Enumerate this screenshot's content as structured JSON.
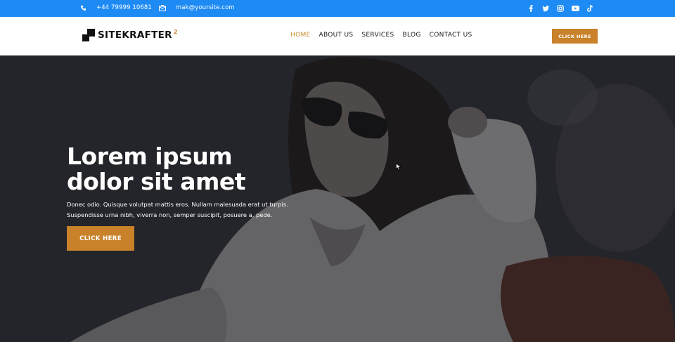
{
  "topbar": {
    "phone": "+44 79999 10681",
    "email": "mak@yoursite.com",
    "icons": [
      "phone-icon",
      "email-icon"
    ],
    "social": [
      "facebook-icon",
      "twitter-icon",
      "instagram-icon",
      "youtube-icon",
      "tiktok-icon"
    ],
    "color": "#1e8bf5"
  },
  "header": {
    "logo_text": "SITEKRAFTER",
    "logo_sup": "2",
    "nav": [
      "HOME",
      "ABOUT US",
      "SERVICES",
      "BLOG",
      "CONTACT US"
    ],
    "active_nav": "HOME",
    "cta": "CLICK HERE",
    "accent": "#c9812a"
  },
  "hero": {
    "title_line1": "Lorem ipsum",
    "title_line2": "dolor sit amet",
    "desc_line1": "Donec odio. Quisque volutpat mattis eros. Nullam malesuada erat ut turpis.",
    "desc_line2": "Suspendisse urna nibh, viverra non, semper suscipit, posuere a, pede.",
    "cta": "CLICK HERE"
  }
}
